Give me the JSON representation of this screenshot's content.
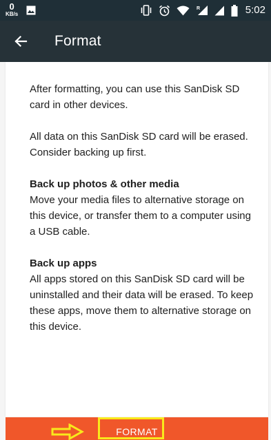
{
  "status_bar": {
    "net_speed_value": "0",
    "net_speed_unit": "KB/s",
    "time": "5:02",
    "icons": [
      "image-icon",
      "vibrate-icon",
      "alarm-icon",
      "wifi-icon",
      "signal-r-icon",
      "signal-icon",
      "battery-icon"
    ]
  },
  "app_bar": {
    "title": "Format",
    "back_icon": "back-arrow-icon"
  },
  "body": {
    "intro": "After formatting, you can use this SanDisk SD card in other devices.",
    "warning": "All data on this SanDisk SD card will be erased. Consider backing up first.",
    "section_media": {
      "heading": "Back up photos & other media",
      "text": "Move your media files to alternative storage on this device, or transfer them to a computer using a USB cable."
    },
    "section_apps": {
      "heading": "Back up apps",
      "text": "All apps stored on this SanDisk SD card will be uninstalled and their data will be erased. To keep these apps, move them to alternative storage on this device."
    }
  },
  "footer": {
    "format_label": "FORMAT"
  },
  "colors": {
    "status_bar": "#1f2f37",
    "app_bar": "#263238",
    "background": "#f5f5f5",
    "card": "#ffffff",
    "format_button": "#f0572a",
    "annotation": "#f9e91b"
  }
}
